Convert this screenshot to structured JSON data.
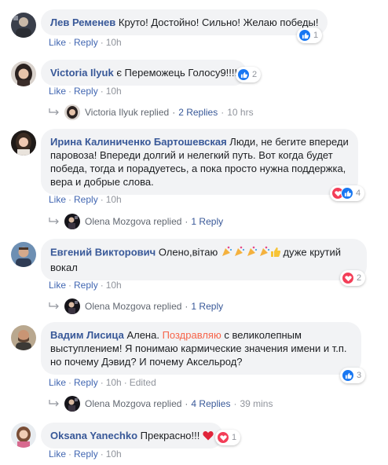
{
  "colors": {
    "link": "#385898",
    "action": "#4267b2",
    "bubble": "#f2f3f5",
    "like": "#1877f2",
    "love": "#f33e58"
  },
  "comments": [
    {
      "author": "Лев Ременев",
      "text": "Круто! Достойно! Сильно! Желаю победы!",
      "actions": {
        "like": "Like",
        "reply": "Reply",
        "time": "10h"
      },
      "reactions": {
        "icons": [
          "like-icon"
        ],
        "count": "1"
      }
    },
    {
      "author": "Victoria Ilyuk",
      "text": "є Переможець Голосу9!!!!",
      "actions": {
        "like": "Like",
        "reply": "Reply",
        "time": "10h"
      },
      "reactions": {
        "icons": [
          "like-icon"
        ],
        "count": "2"
      },
      "replies": {
        "name": "Victoria Ilyuk",
        "verb": "replied",
        "count": "2 Replies",
        "time": "10 hrs"
      }
    },
    {
      "author": "Ирина Калиниченко Бартошевская",
      "text": "Люди, не бегите впереди паровоза! Впереди долгий и нелегкий путь. Вот когда будет победа, тогда и порадуетесь, а пока просто нужна поддержка, вера и добрые слова.",
      "actions": {
        "like": "Like",
        "reply": "Reply",
        "time": "10h"
      },
      "reactions": {
        "icons": [
          "love-icon",
          "like-icon"
        ],
        "count": "4"
      },
      "replies": {
        "name": "Olena Mozgova",
        "verb": "replied",
        "count": "1 Reply"
      }
    },
    {
      "author": "Евгений Викторович",
      "text": "Олено,вітаю",
      "text_tail": "дуже крутий вокал",
      "actions": {
        "like": "Like",
        "reply": "Reply",
        "time": "10h"
      },
      "reactions": {
        "icons": [
          "love-icon"
        ],
        "count": "2"
      },
      "replies": {
        "name": "Olena Mozgova",
        "verb": "replied",
        "count": "1 Reply"
      }
    },
    {
      "author": "Вадим Лисица",
      "text_pre": "Алена.",
      "text_highlight": "Поздравляю",
      "text": "с великолепным выступлением! Я понимаю кармические значения имени и т.п. но почему Дэвид? И почему Аксельрод?",
      "actions": {
        "like": "Like",
        "reply": "Reply",
        "time": "10h",
        "edited": "Edited"
      },
      "reactions": {
        "icons": [
          "like-icon"
        ],
        "count": "3"
      },
      "replies": {
        "name": "Olena Mozgova",
        "verb": "replied",
        "count": "4 Replies",
        "time": "39 mins"
      }
    },
    {
      "author": "Oksana Yanechko",
      "text": "Прекрасно!!!",
      "actions": {
        "like": "Like",
        "reply": "Reply",
        "time": "10h"
      },
      "reactions": {
        "icons": [
          "love-icon"
        ],
        "count": "1"
      }
    }
  ]
}
